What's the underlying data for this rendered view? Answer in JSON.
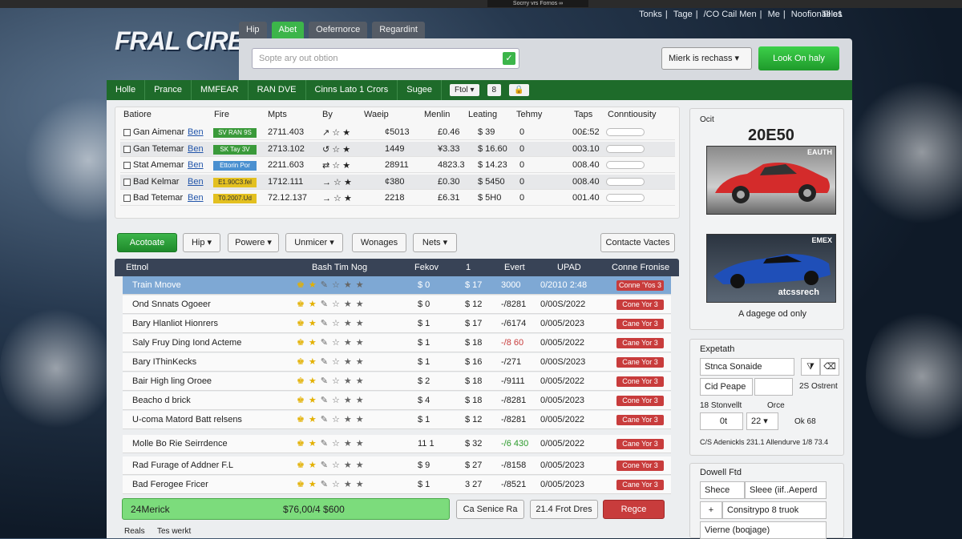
{
  "window": {
    "top_caption": "Socrry vrs Fornos ∞"
  },
  "top_links": [
    "Tonks",
    "Tage",
    "/CO Cail Men",
    "Me",
    "Noofionall o1"
  ],
  "top_links_extra": "Teles",
  "logo": "FRAL CIRE",
  "tabs": [
    "Hip",
    "Abet",
    "Oefernorce",
    "Regardint"
  ],
  "search": {
    "placeholder": "Sopte ary out obtion",
    "ok_icon": "✓"
  },
  "header_dropdown": "Mierk is rechass",
  "header_button": "Look On haly",
  "nav": {
    "items": [
      "Holle",
      "Prance",
      "MMFEAR",
      "RAN DVE",
      "Cinns Lato 1 Crors",
      "Sugee"
    ],
    "select": "Ftol",
    "box2": "8"
  },
  "table1": {
    "headers": [
      "Batiore",
      "Fire",
      "Mpts",
      "By",
      "Waeip",
      "Menlin",
      "Leating",
      "Tehmy",
      "Taps",
      "Conntiousity"
    ],
    "rows": [
      {
        "name": "Gan Aimenar",
        "link": "Ben",
        "tag": "SV RAN 9S",
        "tag_color": "#3a9a3a",
        "mpts": "2711.403",
        "by": "↗ ☆ ★",
        "waeip": "¢5013",
        "menlin": "£0.46",
        "leating": "$ 39",
        "tehmy": "0",
        "taps": "00£:52"
      },
      {
        "name": "Gan Tetemar",
        "link": "Ben",
        "tag": "SK Tay 3V",
        "tag_color": "#3a9a3a",
        "mpts": "2713.102",
        "by": "↺ ☆ ★",
        "waeip": "1449",
        "menlin": "¥3.33",
        "leating": "$ 16.60",
        "tehmy": "0",
        "taps": "003.10"
      },
      {
        "name": "Stat Amemar",
        "link": "Ben",
        "tag": "Ettorin Por",
        "tag_color": "#4a90d0",
        "mpts": "2211.603",
        "by": "⇄ ☆ ★",
        "waeip": "28911",
        "menlin": "4823.3",
        "leating": "$ 14.23",
        "tehmy": "0",
        "taps": "008.40"
      },
      {
        "name": "Bad Kelmar",
        "link": "Ben",
        "tag": "E1.90C3.fel",
        "tag_color": "#e3c020",
        "mpts": "1712.111",
        "by": "→ ☆ ★",
        "waeip": "¢380",
        "menlin": "£0.30",
        "leating": "$ 5450",
        "tehmy": "0",
        "taps": "008.40"
      },
      {
        "name": "Bad Tetemar",
        "link": "Ben",
        "tag": "T0.2007.Ud",
        "tag_color": "#e3c020",
        "mpts": "72.12.137",
        "by": "→ ☆ ★",
        "waeip": "2218",
        "menlin": "£6.31",
        "leating": "$ 5H0",
        "tehmy": "0",
        "taps": "001.40"
      }
    ]
  },
  "toolbar": {
    "primary": "Acotoate",
    "d1": "Hip",
    "d2": "Powere",
    "d3": "Unmicer",
    "d4": "Wonages",
    "d5": "Nets",
    "right": "Contacte Vactes"
  },
  "table2": {
    "headers": [
      "Ettnol",
      "Bash Tim Nog",
      "Fekov",
      "1",
      "Evert",
      "UPAD",
      "Conne Fronise"
    ],
    "rows": [
      {
        "name": "Train Mnove",
        "fekov": "$ 0",
        "one": "$ 17",
        "evert": "3000",
        "upad": "0/2010 2:48",
        "badge": "Conne 'Yos 3",
        "selected": true,
        "green": false
      },
      {
        "name": "Ond Snnats Ogoeer",
        "fekov": "$ 0",
        "one": "$ 12",
        "evert": "-/8281",
        "upad": "0/00S/2022",
        "badge": "Cone Yor 3",
        "selected": false,
        "green": false
      },
      {
        "name": "Bary Hlanliot Hionrers",
        "fekov": "$ 1",
        "one": "$ 17",
        "evert": "-/6174",
        "upad": "0/005/2023",
        "badge": "Cane Yor 3",
        "selected": false,
        "green": false
      },
      {
        "name": "Saly Fruy Ding Iond Acteme",
        "fekov": "$ 1",
        "one": "$ 18",
        "evert": "-/8 60",
        "upad": "0/005/2022",
        "badge": "Cane Yor 3",
        "selected": false,
        "green": false
      },
      {
        "name": "Bary IThinKecks",
        "fekov": "$ 1",
        "one": "$ 16",
        "evert": "-/271",
        "upad": "0/00S/2023",
        "badge": "Cane Yor 3",
        "selected": false,
        "green": false
      },
      {
        "name": "Bair High ling Oroee",
        "fekov": "$ 2",
        "one": "$ 18",
        "evert": "-/9111",
        "upad": "0/005/2022",
        "badge": "Cone Yor 3",
        "selected": false,
        "green": false
      },
      {
        "name": "Beacho d brick",
        "fekov": "$ 4",
        "one": "$ 18",
        "evert": "-/8281",
        "upad": "0/005/2023",
        "badge": "Cone Yor 3",
        "selected": false,
        "green": false
      },
      {
        "name": "U-coma Matord Batt relsens",
        "fekov": "$ 1",
        "one": "$ 12",
        "evert": "-/8281",
        "upad": "0/005/2022",
        "badge": "Cane Yor 3",
        "selected": false,
        "green": false
      },
      {
        "name": "Molle Bo Rie Seirrdence",
        "fekov": "11 1",
        "one": "$ 32",
        "evert": "-/6 430",
        "upad": "0/005/2022",
        "badge": "Cane Yor 3",
        "selected": false,
        "green": true
      },
      {
        "name": "Rad Furage of Addner F.L",
        "fekov": "$ 9",
        "one": "$ 27",
        "evert": "-/8158",
        "upad": "0/005/2023",
        "badge": "Cone Yor 3",
        "selected": false,
        "green": false
      },
      {
        "name": "Bad Ferogee Fricer",
        "fekov": "$ 1",
        "one": "3 27",
        "evert": "-/8521",
        "upad": "0/005/2023",
        "badge": "Cane Yor 3",
        "selected": false,
        "green": false
      }
    ]
  },
  "footer": {
    "label": "24Merick",
    "amount": "$76,00/4 $600",
    "b1": "Ca Senice Ra",
    "b2": "21.4 Frot Dres",
    "b3": "Regce",
    "left": "Reals",
    "left2": "Tes werkt"
  },
  "side1": {
    "label": "Ocit",
    "year": "20E50",
    "car1_tag": "EAUTH",
    "car2_tag": "EMEX",
    "car2_caption": "atcssrech",
    "caption": "A dagege od only"
  },
  "side2": {
    "title": "Expetath",
    "f1": "Stnca Sonaide",
    "f2": "Cid Peape",
    "f2_note": "2S Ostrent",
    "f3_label": "18 Stonvellt",
    "f3_note": "Orce",
    "f3_val": "0t",
    "f3_sel": "22",
    "f3_right": "Ok 68",
    "bottom": "C/S Adenickls 231.1 Allendurve 1/8 73.4"
  },
  "side3": {
    "title": "Dowell Ftd",
    "f1": "Shece",
    "f1b": "Sleee (iif..Aeperd",
    "f2": "+",
    "f2b": "Consitrypo 8 truok",
    "f3": "Vierne (boqjage)"
  },
  "colors": {
    "nav_green": "#1e6b2a",
    "accent_green": "#3cb54a",
    "header_dark": "#384356",
    "red": "#c83c3c",
    "select_blue": "#7ea8d4"
  }
}
